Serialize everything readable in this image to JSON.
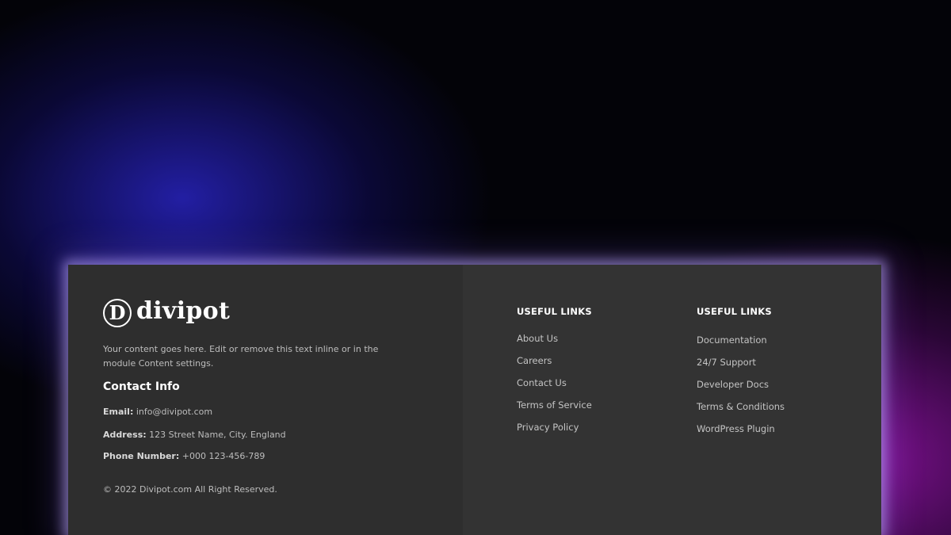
{
  "footer": {
    "logo": {
      "mark": "D",
      "name": "divipot"
    },
    "description": "Your content goes here. Edit or remove this text inline or in the module Content settings.",
    "contact": {
      "heading": "Contact Info",
      "email_label": "Email:",
      "email_value": "info@divipot.com",
      "address_label": "Address:",
      "address_value": "123 Street Name, City. England",
      "phone_label": "Phone Number:",
      "phone_value": "+000 123-456-789"
    },
    "copyright": "© 2022 Divipot.com All Right Reserved.",
    "links_1": {
      "heading": "USEFUL LINKS",
      "items": [
        "About Us",
        "Careers",
        "Contact Us",
        "Terms of Service",
        "Privacy Policy"
      ]
    },
    "links_2": {
      "heading": "USEFUL LINKS",
      "items": [
        "Documentation",
        "24/7 Support",
        "Developer Docs",
        "Terms & Conditions",
        "WordPress Plugin"
      ]
    }
  },
  "colors": {
    "panel_left": "#2e2e2e",
    "panel_right": "#333333",
    "glow": "#beaaff",
    "heading_text": "#ffffff",
    "body_text": "#bdbdbd"
  }
}
